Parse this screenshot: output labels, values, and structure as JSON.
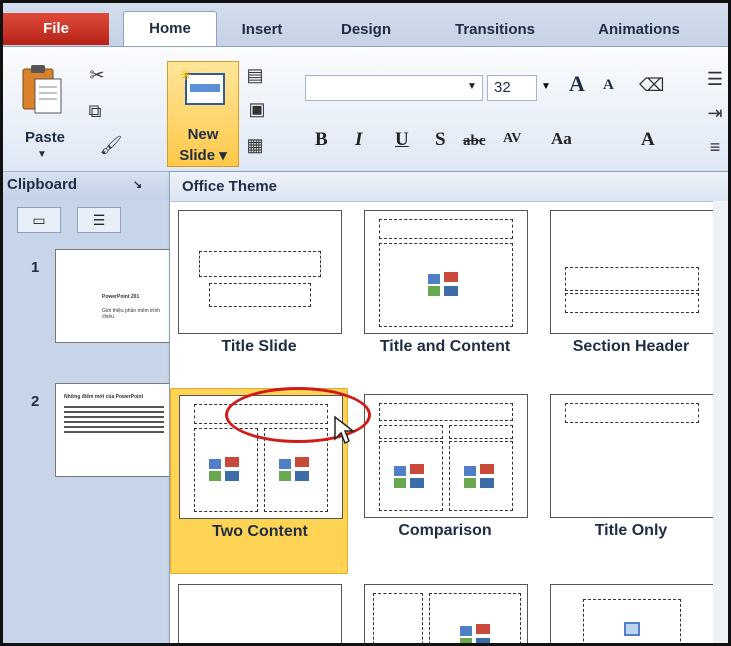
{
  "tabs": [
    {
      "label": "File"
    },
    {
      "label": "Home"
    },
    {
      "label": "Insert"
    },
    {
      "label": "Design"
    },
    {
      "label": "Transitions"
    },
    {
      "label": "Animations"
    }
  ],
  "ribbon": {
    "paste_label": "Paste",
    "new_slide_label_1": "New",
    "new_slide_label_2": "Slide",
    "font_name": "",
    "font_size": "32",
    "grow_font": "A",
    "shrink_font": "A",
    "bold": "B",
    "italic": "I",
    "underline": "U",
    "shadow": "S",
    "strike": "abc",
    "spacing": "AV",
    "change_case": "Aa",
    "font_color": "A"
  },
  "groups": {
    "clipboard": "Clipboard"
  },
  "gallery": {
    "title": "Office Theme",
    "layouts": [
      {
        "name": "Title Slide"
      },
      {
        "name": "Title and Content"
      },
      {
        "name": "Section Header"
      },
      {
        "name": "Two Content",
        "selected": true
      },
      {
        "name": "Comparison"
      },
      {
        "name": "Title Only"
      }
    ]
  },
  "slides": [
    {
      "number": "1",
      "title": "PowerPoint 201",
      "sub": "Giới thiệu phần mềm trình chiếu"
    },
    {
      "number": "2",
      "title": "Những điểm mới của PowerPoint"
    }
  ],
  "colors": {
    "file_tab": "#c72d1f",
    "selected": "#ffd455",
    "highlight_ring": "#d11a1a"
  }
}
